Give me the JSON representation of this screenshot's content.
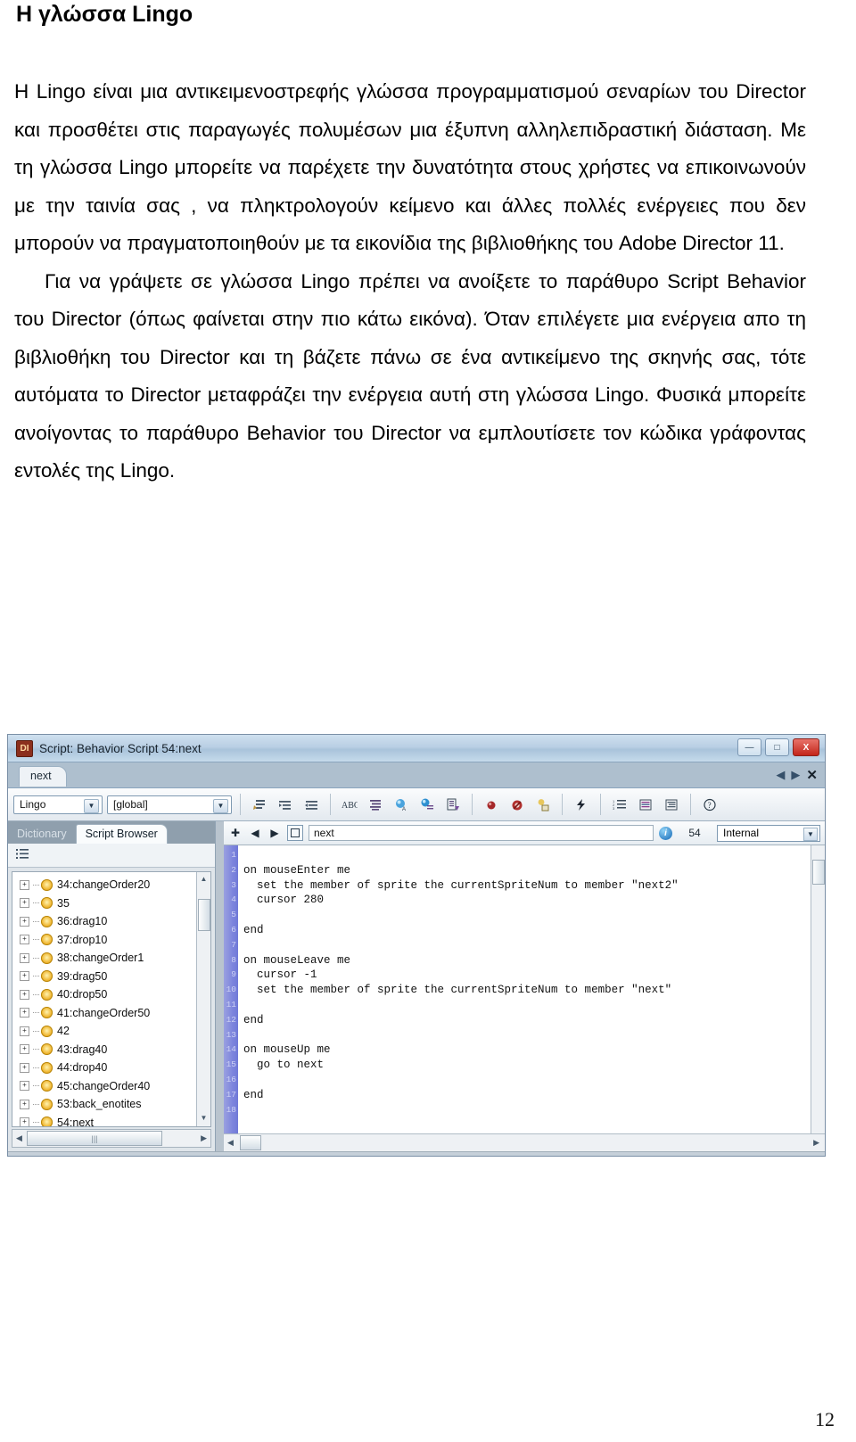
{
  "document": {
    "title": "Η γλώσσα Lingo",
    "paragraph": "Η Lingo είναι μια αντικειμενοστρεφής γλώσσα προγραμματισμού σεναρίων του Director και προσθέτει στις παραγωγές πολυμέσων  μια έξυπνη αλληλεπιδραστική διάσταση. Με τη γλώσσα Lingo μπορείτε να παρέχετε την δυνατότητα στους χρήστες να επικοινωνούν με την ταινία σας , να πληκτρολογούν κείμενο και άλλες πολλές ενέργειες που δεν μπορούν να πραγματοποιηθούν με τα εικονίδια της βιβλιοθήκης του Adobe Director 11.",
    "paragraph2": "Για να γράψετε σε γλώσσα Lingo πρέπει να ανοίξετε το παράθυρο Script Behavior  του Director (όπως φαίνεται στην πιο κάτω εικόνα). Όταν επιλέγετε μια ενέργεια απο τη βιβλιοθήκη του Director και τη βάζετε πάνω σε ένα αντικείμενο της σκηνής σας, τότε αυτόματα το Director μεταφράζει την ενέργεια αυτή στη γλώσσα Lingo. Φυσικά μπορείτε ανοίγοντας το παράθυρο Behavior  του Director να εμπλουτίσετε τον κώδικα γράφοντας εντολές της Lingo.",
    "page_number": "12"
  },
  "screenshot": {
    "window": {
      "app_badge": "DI",
      "title": "Script: Behavior Script 54:next",
      "minimize_label": "—",
      "maximize_label": "□",
      "close_label": "X"
    },
    "doc_tab": "next",
    "tab_nav": {
      "prev": "◀",
      "next": "▶",
      "close": "✕"
    },
    "toolbar": {
      "language_select": "Lingo",
      "scope_select": "[global]",
      "dropdown_arrow": "▼",
      "icons": [
        "comment-icon",
        "indent-icon",
        "outdent-icon",
        "alphabetize-icon",
        "align-icon",
        "go-to-handler-icon",
        "go-to-script-icon",
        "recompile-icon",
        "toggle-breakpoint-icon",
        "ignore-breakpoints-icon",
        "watch-expression-icon",
        "run-script-icon",
        "line-numbers-icon",
        "code-color-icon",
        "code-indent-icon",
        "help-icon"
      ],
      "help_glyph": "?"
    },
    "left_panel": {
      "tabs": [
        {
          "label": "Dictionary",
          "active": false
        },
        {
          "label": "Script Browser",
          "active": true
        }
      ],
      "list_icon": "list-view-icon",
      "tree_items": [
        "34:changeOrder20",
        "35",
        "36:drag10",
        "37:drop10",
        "38:changeOrder1",
        "39:drag50",
        "40:drop50",
        "41:changeOrder50",
        "42",
        "43:drag40",
        "44:drop40",
        "45:changeOrder40",
        "53:back_enotites",
        "54:next"
      ],
      "expander": "+",
      "scroll_up": "▲",
      "scroll_down": "▼",
      "scroll_left": "◀",
      "scroll_right": "▶",
      "grip": "|||"
    },
    "code_panel": {
      "add_button": "✚",
      "prev_button": "◀",
      "next_button": "▶",
      "script_icon": "script-box-icon",
      "member_name": "next",
      "info_icon": "i",
      "cast_number": "54",
      "cast_library": "Internal",
      "dropdown_arrow": "▼",
      "line_numbers": [
        "1",
        "2",
        "3",
        "4",
        "5",
        "6",
        "7",
        "8",
        "9",
        "10",
        "11",
        "12",
        "13",
        "14",
        "15",
        "16",
        "17",
        "18"
      ],
      "code": "\non mouseEnter me\n  set the member of sprite the currentSpriteNum to member \"next2\"\n  cursor 280\n\nend\n\non mouseLeave me\n  cursor -1\n  set the member of sprite the currentSpriteNum to member \"next\"\n\nend\n\non mouseUp me\n  go to next\n\nend\n",
      "scroll_left": "◀",
      "scroll_right": "▶"
    }
  },
  "colors": {
    "titlebar": "#b9cfe4",
    "gutter": "#7e86dd",
    "close_button": "#c3251a",
    "accent": "#8b2f1d"
  }
}
